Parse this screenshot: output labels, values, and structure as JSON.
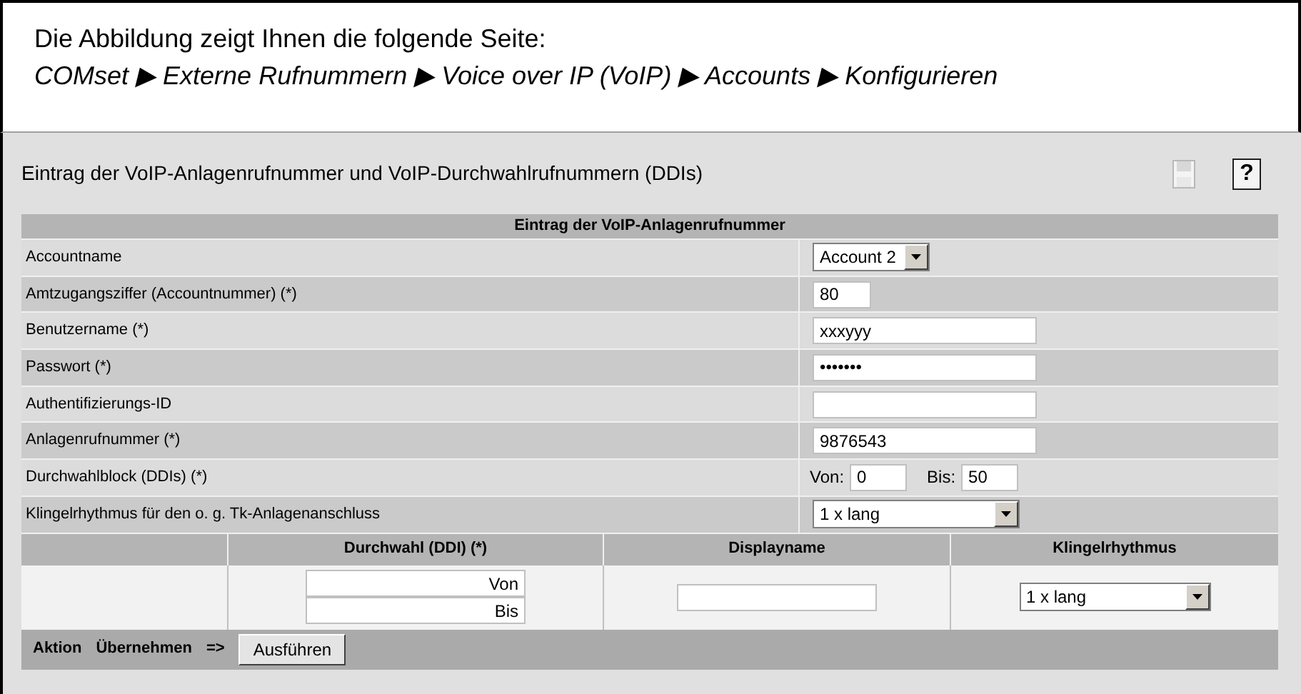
{
  "caption": {
    "intro": "Die Abbildung zeigt Ihnen die folgende Seite:",
    "path": [
      "COMset",
      "Externe Rufnummern",
      "Voice over IP (VoIP)",
      "Accounts",
      "Konfigurieren"
    ],
    "separator": "▶"
  },
  "page_title": "Eintrag der VoIP-Anlagenrufnummer und VoIP-Durchwahlrufnummern (DDIs)",
  "save_disabled": true,
  "help_label": "?",
  "table": {
    "header": "Eintrag der VoIP-Anlagenrufnummer",
    "rows": [
      {
        "label": "Accountname",
        "kind": "select",
        "value": "Account 2"
      },
      {
        "label": "Amtzugangsziffer (Accountnummer) (*)",
        "kind": "short",
        "value": "80"
      },
      {
        "label": "Benutzername (*)",
        "kind": "text",
        "value": "xxxyyy"
      },
      {
        "label": "Passwort (*)",
        "kind": "text",
        "value": "•••••••"
      },
      {
        "label": "Authentifizierungs-ID",
        "kind": "text",
        "value": ""
      },
      {
        "label": "Anlagenrufnummer (*)",
        "kind": "text",
        "value": "9876543"
      },
      {
        "label": "Durchwahlblock (DDIs) (*)",
        "kind": "range",
        "from_label": "Von:",
        "from": "0",
        "to_label": "Bis:",
        "to": "50"
      },
      {
        "label": "Klingelrhythmus für den o. g. Tk-Anlagenanschluss",
        "kind": "wideselect",
        "value": "1 x lang"
      }
    ]
  },
  "ddi_table": {
    "columns": [
      "Durchwahl (DDI) (*)",
      "Displayname",
      "Klingelrhythmus"
    ],
    "from_value": "Von",
    "to_value": "Bis",
    "ring_value": "1 x lang"
  },
  "action_bar": {
    "label": "Aktion",
    "action": "Übernehmen",
    "arrow": "=>",
    "button": "Ausführen"
  }
}
